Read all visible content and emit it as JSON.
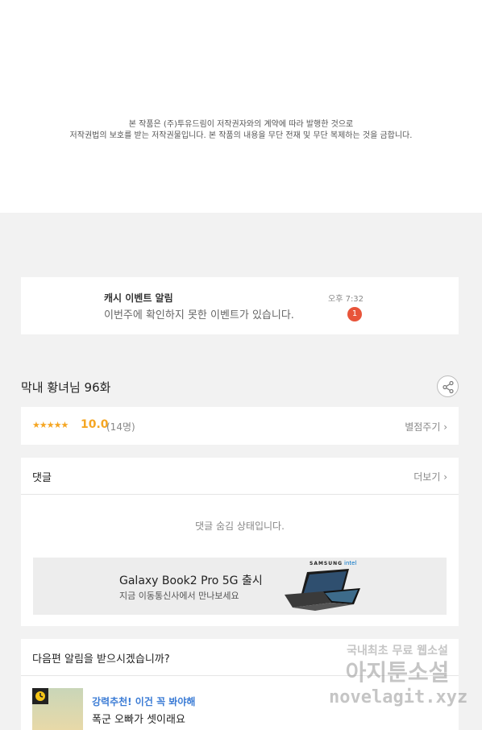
{
  "copyright": {
    "line1": "본 작품은 (주)투유드림이 저작권자와의 계약에 따라 발행한 것으로",
    "line2": "저작권법의 보호를 받는 저작권물입니다. 본 작품의 내용을 무단 전재 및 무단 복제하는 것을 금합니다."
  },
  "notice": {
    "title": "캐시 이벤트 알림",
    "body": "이번주에 확인하지 못한 이벤트가 있습니다.",
    "time": "오후 7:32",
    "badge": "1"
  },
  "episode": {
    "title": "막내 황녀님 96화",
    "share_icon": "share-icon"
  },
  "rating": {
    "stars": "★★★★★",
    "score": "10.0",
    "count": "(14명)",
    "rate_link": "별점주기 ›"
  },
  "comments": {
    "title": "댓글",
    "more": "더보기 ›",
    "hidden_text": "댓글 숨김 상태입니다."
  },
  "ad": {
    "title": "Galaxy Book2 Pro 5G 출시",
    "subtitle": "지금 이동통신사에서 만나보세요",
    "brand": "SAMSUNG",
    "partner": "intel"
  },
  "next": {
    "title": "다음편 알림을 받으시겠습니까?",
    "recommend": "강력추천! 이건 꼭 봐야해",
    "name": "폭군 오빠가 셋이래요"
  },
  "watermark": {
    "line1": "국내최초 무료 웹소설",
    "line2": "아지툰소설",
    "line3": "novelagit.xyz"
  },
  "colors": {
    "accent_star": "#f5a623",
    "badge": "#e8543a",
    "link_blue": "#3a7bd5"
  }
}
